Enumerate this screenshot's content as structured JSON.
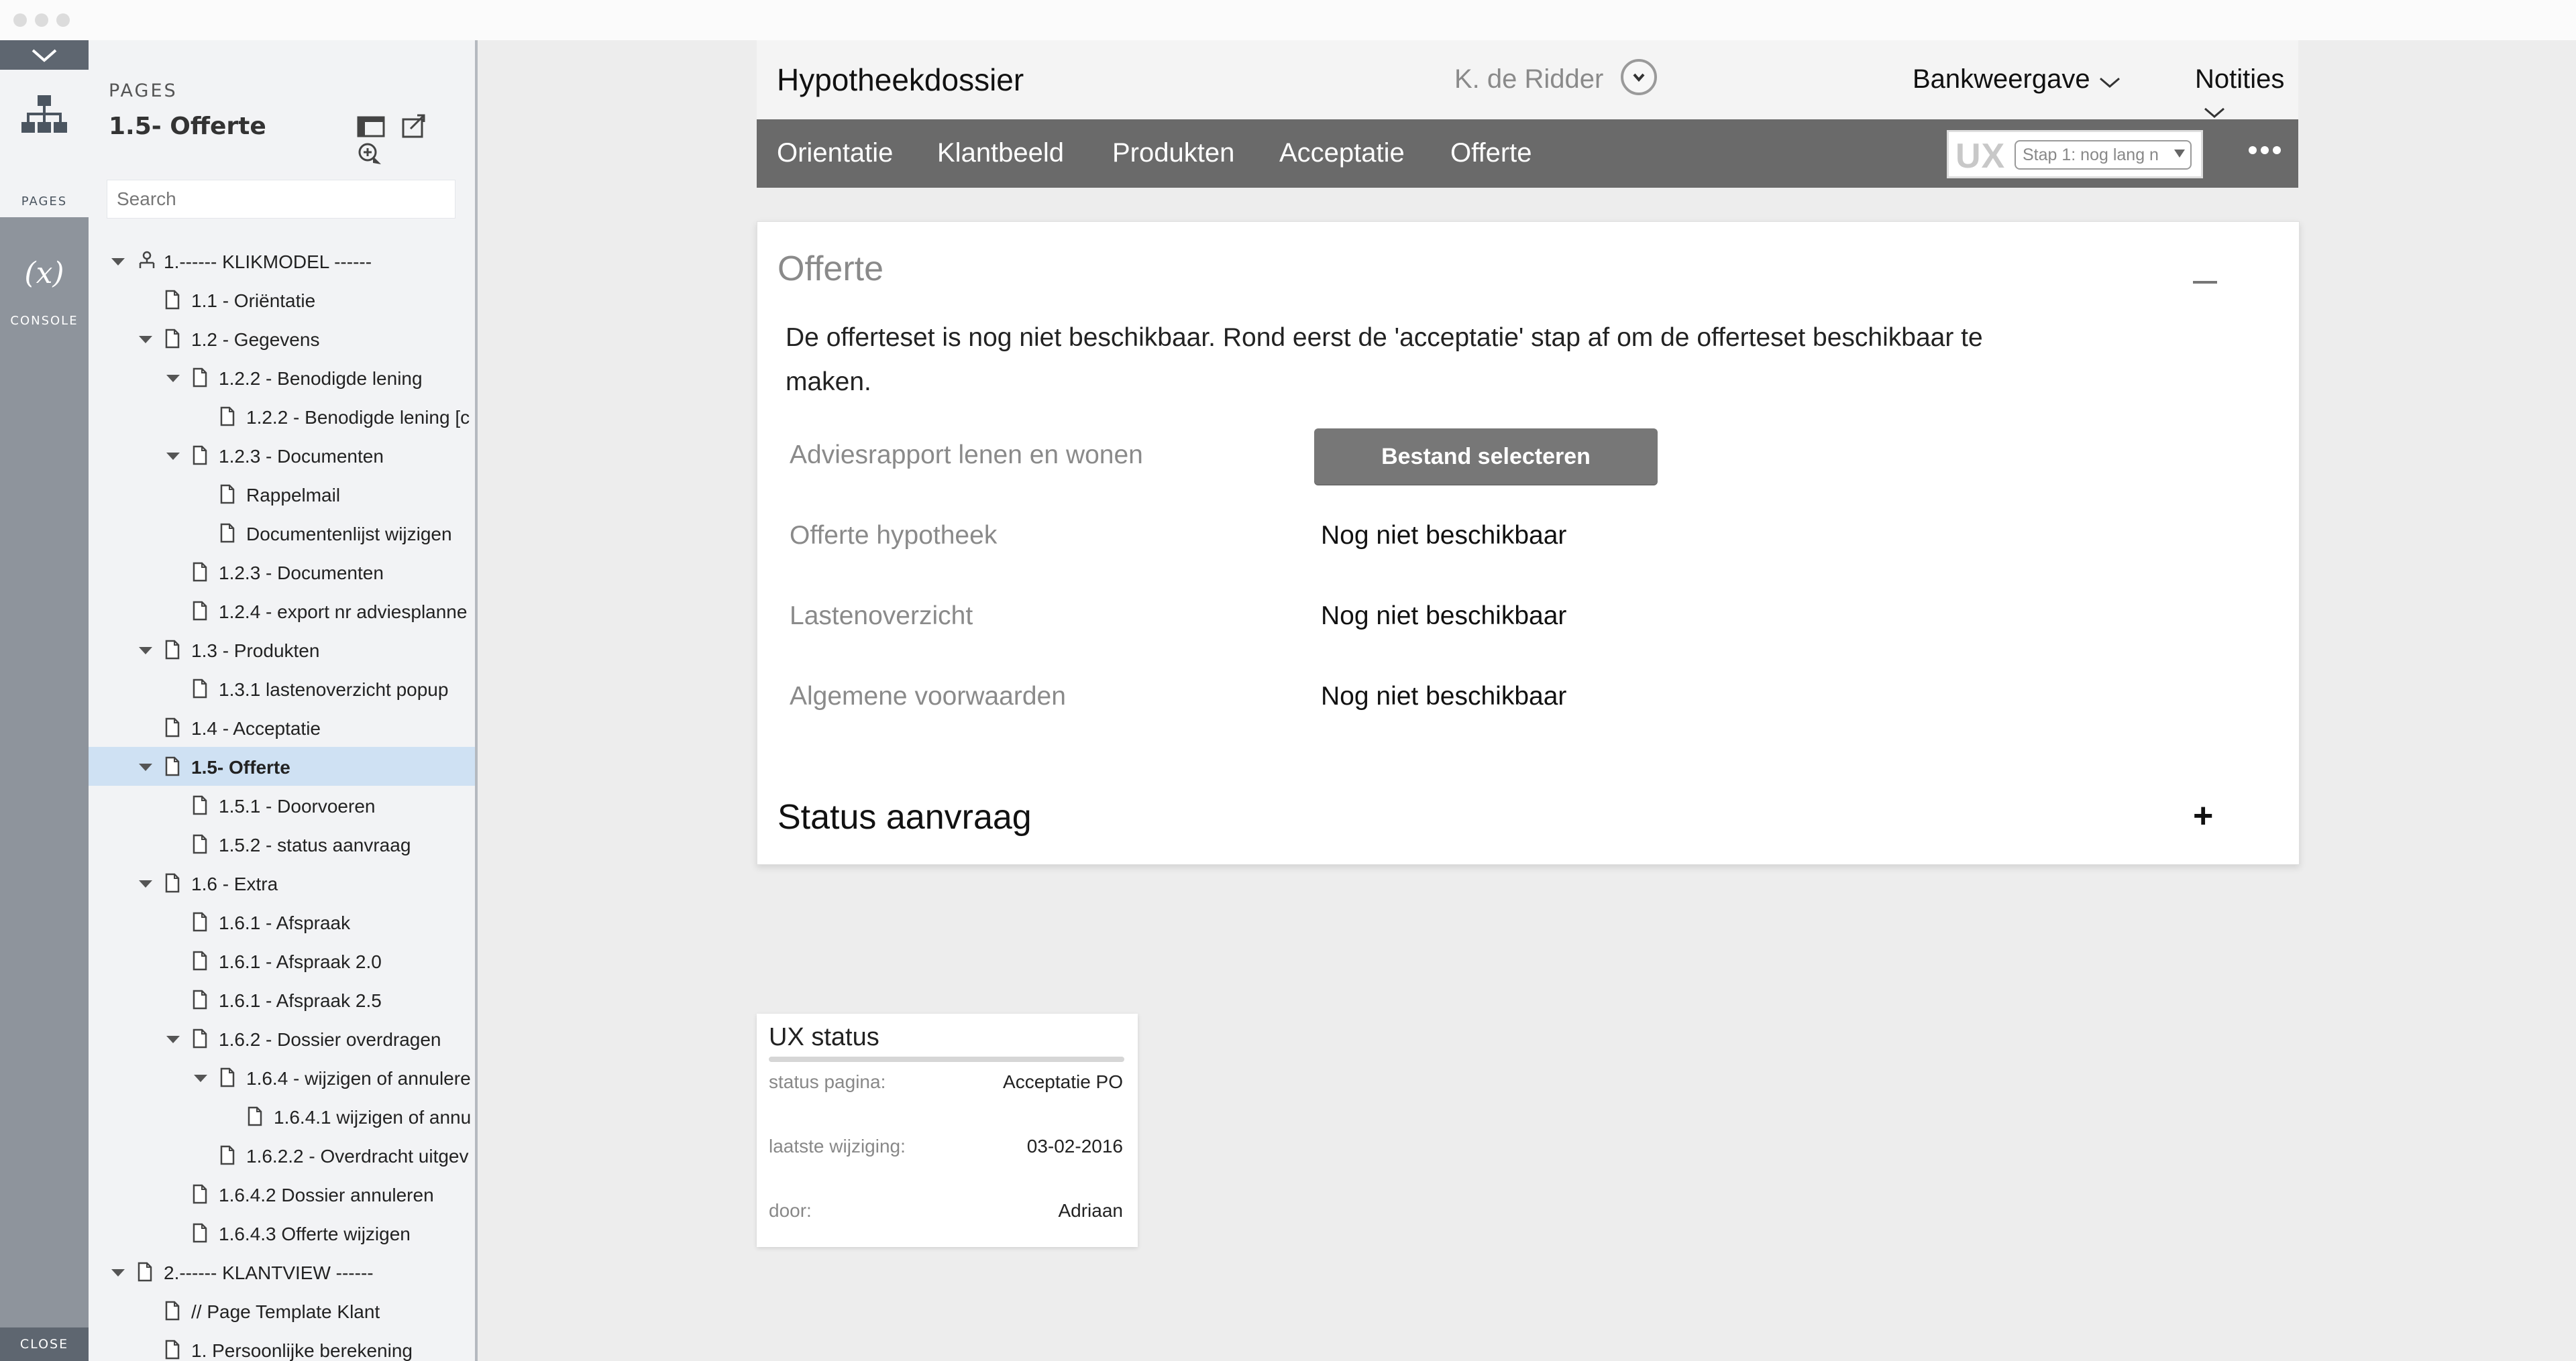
{
  "rail": {
    "pages_label": "PAGES",
    "console_symbol": "(x)",
    "console_label": "CONSOLE",
    "close_label": "CLOSE"
  },
  "panel": {
    "heading": "PAGES",
    "current_page": "1.5- Offerte",
    "search_placeholder": "Search",
    "tree": [
      {
        "label": "1.------ KLIKMODEL ------",
        "level": 0,
        "expanded": true,
        "icon": "sitemap-icon"
      },
      {
        "label": "1.1 - Oriëntatie",
        "level": 1,
        "expanded": null,
        "icon": "page-icon"
      },
      {
        "label": "1.2 - Gegevens",
        "level": 1,
        "expanded": true,
        "icon": "page-icon"
      },
      {
        "label": "1.2.2 - Benodigde lening",
        "level": 2,
        "expanded": true,
        "icon": "page-icon"
      },
      {
        "label": "1.2.2 - Benodigde lening [c",
        "level": 3,
        "expanded": null,
        "icon": "page-icon"
      },
      {
        "label": "1.2.3 - Documenten",
        "level": 2,
        "expanded": true,
        "icon": "page-icon"
      },
      {
        "label": "Rappelmail",
        "level": 3,
        "expanded": null,
        "icon": "page-icon"
      },
      {
        "label": "Documentenlijst wijzigen",
        "level": 3,
        "expanded": null,
        "icon": "page-icon"
      },
      {
        "label": "1.2.3 - Documenten",
        "level": 2,
        "expanded": null,
        "icon": "page-icon"
      },
      {
        "label": "1.2.4 - export nr adviesplanne",
        "level": 2,
        "expanded": null,
        "icon": "page-icon"
      },
      {
        "label": "1.3 - Produkten",
        "level": 1,
        "expanded": true,
        "icon": "page-icon"
      },
      {
        "label": "1.3.1 lastenoverzicht popup",
        "level": 2,
        "expanded": null,
        "icon": "page-icon"
      },
      {
        "label": "1.4 - Acceptatie",
        "level": 1,
        "expanded": null,
        "icon": "page-icon"
      },
      {
        "label": "1.5- Offerte",
        "level": 1,
        "expanded": true,
        "icon": "page-icon",
        "selected": true
      },
      {
        "label": "1.5.1 - Doorvoeren",
        "level": 2,
        "expanded": null,
        "icon": "page-icon"
      },
      {
        "label": "1.5.2 - status aanvraag",
        "level": 2,
        "expanded": null,
        "icon": "page-icon"
      },
      {
        "label": "1.6 - Extra",
        "level": 1,
        "expanded": true,
        "icon": "page-icon"
      },
      {
        "label": "1.6.1 - Afspraak",
        "level": 2,
        "expanded": null,
        "icon": "page-icon"
      },
      {
        "label": "1.6.1 - Afspraak 2.0",
        "level": 2,
        "expanded": null,
        "icon": "page-icon"
      },
      {
        "label": "1.6.1 - Afspraak 2.5",
        "level": 2,
        "expanded": null,
        "icon": "page-icon"
      },
      {
        "label": "1.6.2 - Dossier overdragen",
        "level": 2,
        "expanded": true,
        "icon": "page-icon"
      },
      {
        "label": "1.6.4 - wijzigen of annulere",
        "level": 3,
        "expanded": true,
        "icon": "page-icon"
      },
      {
        "label": "1.6.4.1 wijzigen of annu",
        "level": 4,
        "expanded": null,
        "icon": "page-icon"
      },
      {
        "label": "1.6.2.2 - Overdracht uitgev",
        "level": 3,
        "expanded": null,
        "icon": "page-icon"
      },
      {
        "label": "1.6.4.2 Dossier annuleren",
        "level": 2,
        "expanded": null,
        "icon": "page-icon"
      },
      {
        "label": "1.6.4.3 Offerte wijzigen",
        "level": 2,
        "expanded": null,
        "icon": "page-icon"
      },
      {
        "label": "2.------ KLANTVIEW ------",
        "level": 0,
        "expanded": true,
        "icon": "page-icon"
      },
      {
        "label": "// Page Template Klant",
        "level": 1,
        "expanded": null,
        "icon": "page-icon"
      },
      {
        "label": "1. Persoonlijke berekening",
        "level": 1,
        "expanded": null,
        "icon": "page-icon"
      }
    ]
  },
  "header": {
    "title": "Hypotheekdossier",
    "user_name": "K. de Ridder",
    "dropdowns": [
      "Bankweergave",
      "Notities"
    ]
  },
  "nav": {
    "items": [
      "Orientatie",
      "Klantbeeld",
      "Produkten",
      "Acceptatie",
      "Offerte"
    ],
    "ux_logo": "UX",
    "ux_select_value": "Stap 1: nog lang n"
  },
  "offerte": {
    "title": "Offerte",
    "message": "De offerteset is nog niet beschikbaar. Rond eerst de 'acceptatie' stap af om de offerteset beschikbaar te maken.",
    "rows": [
      {
        "label": "Adviesrapport lenen en wonen",
        "button": "Bestand selecteren"
      },
      {
        "label": "Offerte hypotheek",
        "value": "Nog niet beschikbaar"
      },
      {
        "label": "Lastenoverzicht",
        "value": "Nog niet beschikbaar"
      },
      {
        "label": "Algemene voorwaarden",
        "value": "Nog niet beschikbaar"
      }
    ],
    "status_title": "Status aanvraag",
    "collapse_symbol": "—",
    "expand_symbol": "+"
  },
  "ux_status": {
    "title": "UX status",
    "rows": [
      {
        "label": "status pagina:",
        "value": "Acceptatie PO"
      },
      {
        "label": "laatste wijziging:",
        "value": "03-02-2016"
      },
      {
        "label": "door:",
        "value": "Adriaan"
      }
    ]
  },
  "colors": {
    "rail": "#8e949c",
    "navbar": "#6a6a6a",
    "selected_row": "#cfe1f3",
    "button": "#777777"
  }
}
